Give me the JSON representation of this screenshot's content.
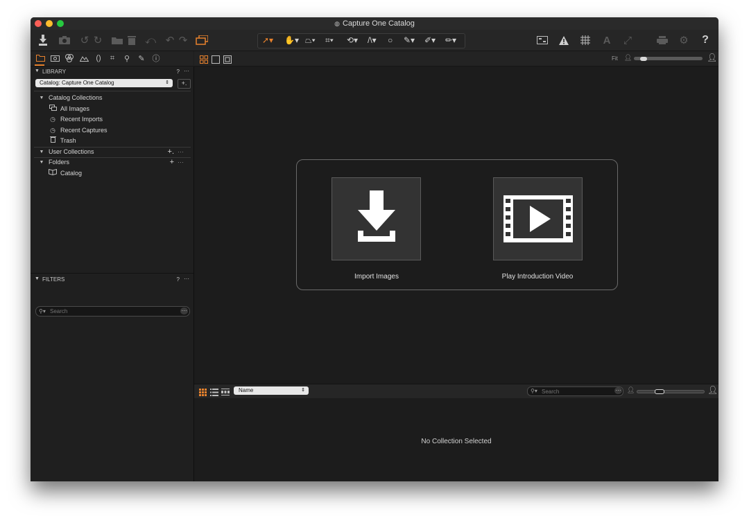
{
  "window": {
    "title": "Capture One Catalog",
    "title_icon": "catalog-icon"
  },
  "colors": {
    "accent": "#e8822d",
    "close": "#fd5f57",
    "minimize": "#fdbc2e",
    "zoom": "#27c940",
    "background": "#1d1d1d"
  },
  "toolbar": {
    "left_icons": [
      "import-icon",
      "camera-icon",
      "rotate-left-icon",
      "rotate-right-icon",
      "move-to-folder-icon",
      "trash-icon",
      "undo-all-icon",
      "undo-icon",
      "redo-icon",
      "variant-stack-icon"
    ],
    "cursor_tools": [
      "select-cursor-icon",
      "pan-hand-icon",
      "keystone-icon",
      "crop-icon",
      "rotate-tool-icon",
      "straighten-icon",
      "circle-icon",
      "brush-icon",
      "eyedropper-icon",
      "annotate-icon"
    ],
    "right_icons": [
      "compare-icon",
      "exposure-warning-icon",
      "grid-icon",
      "text-overlay-icon",
      "proof-icon",
      "print-icon",
      "settings-gear-icon",
      "help-icon"
    ],
    "help_label": "?"
  },
  "left_tabs": [
    "library-folder-icon",
    "capture-camera-icon",
    "color-icon",
    "exposure-icon",
    "lens-icon",
    "crop-tab-icon",
    "details-icon",
    "adjustments-icon",
    "metadata-info-icon"
  ],
  "library": {
    "header": "LIBRARY",
    "help": "?",
    "menu": "···",
    "catalog_select": "Catalog: Capture One Catalog",
    "add_label": "+.",
    "catalog_collections": {
      "label": "Catalog Collections",
      "items": [
        {
          "label": "All Images",
          "icon": "images-stack-icon"
        },
        {
          "label": "Recent Imports",
          "icon": "clock-icon"
        },
        {
          "label": "Recent Captures",
          "icon": "clock-icon"
        },
        {
          "label": "Trash",
          "icon": "trash-icon"
        }
      ]
    },
    "user_collections": {
      "label": "User Collections",
      "add": "+.",
      "more": "···"
    },
    "folders": {
      "label": "Folders",
      "add": "+",
      "more": "···",
      "items": [
        {
          "label": "Catalog",
          "icon": "book-icon"
        }
      ]
    }
  },
  "filters": {
    "header": "FILTERS",
    "help": "?",
    "menu": "···",
    "search_placeholder": "Search",
    "search_menu": "···"
  },
  "viewer_top": {
    "fit_label": "Fit"
  },
  "welcome": {
    "import_label": "Import Images",
    "video_label": "Play Introduction Video"
  },
  "browser": {
    "sort_label": "Name",
    "search_placeholder": "Search",
    "search_menu": "···",
    "empty_message": "No Collection Selected"
  },
  "zoom": {
    "viewer_level": 0.1,
    "browser_level": 0.3
  }
}
